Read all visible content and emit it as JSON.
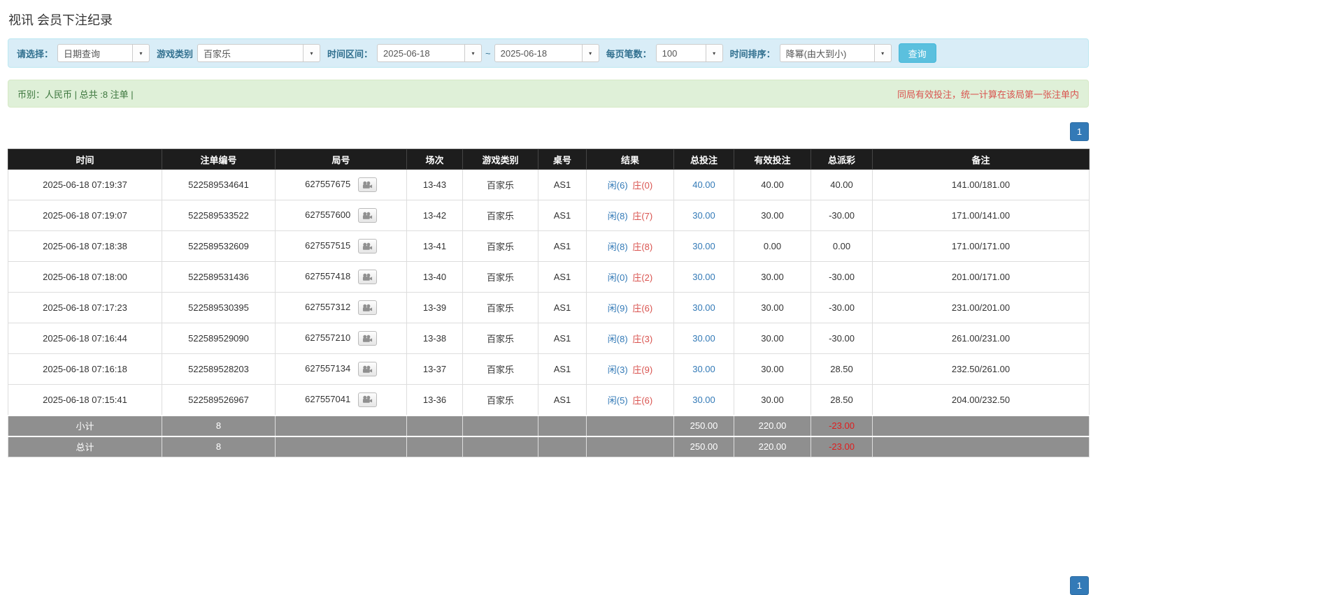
{
  "page": {
    "title": "视讯 会员下注纪录"
  },
  "filters": {
    "caret": "▾",
    "select_label": "请选择：",
    "select_value": "日期查询",
    "game_label": "游戏类别",
    "game_value": "百家乐",
    "range_label": "时间区间：",
    "date_from": "2025-06-18",
    "range_separator": "~",
    "date_to": "2025-06-18",
    "page_size_label": "每页笔数：",
    "page_size_value": "100",
    "sort_label": "时间排序：",
    "sort_value": "降幂(由大到小)",
    "search_label": "查询"
  },
  "summary_bar": {
    "left": "币别：人民币 | 总共 :8 注单 |",
    "right": "同局有效投注，统一计算在该局第一张注单内"
  },
  "pagination": {
    "current_page": "1"
  },
  "table": {
    "headers": [
      "时间",
      "注单编号",
      "局号",
      "场次",
      "游戏类别",
      "桌号",
      "结果",
      "总投注",
      "有效投注",
      "总派彩",
      "备注"
    ],
    "rows": [
      {
        "time": "2025-06-18 07:19:37",
        "bet_no": "522589534641",
        "round_no": "627557675",
        "session": "13-43",
        "game_type": "百家乐",
        "table_no": "AS1",
        "result_player": "闲(6)",
        "result_banker": "庄(0)",
        "total_bet": "40.00",
        "valid_bet": "40.00",
        "payout": "40.00",
        "note": "141.00/181.00"
      },
      {
        "time": "2025-06-18 07:19:07",
        "bet_no": "522589533522",
        "round_no": "627557600",
        "session": "13-42",
        "game_type": "百家乐",
        "table_no": "AS1",
        "result_player": "闲(8)",
        "result_banker": "庄(7)",
        "total_bet": "30.00",
        "valid_bet": "30.00",
        "payout": "-30.00",
        "note": "171.00/141.00"
      },
      {
        "time": "2025-06-18 07:18:38",
        "bet_no": "522589532609",
        "round_no": "627557515",
        "session": "13-41",
        "game_type": "百家乐",
        "table_no": "AS1",
        "result_player": "闲(8)",
        "result_banker": "庄(8)",
        "total_bet": "30.00",
        "valid_bet": "0.00",
        "payout": "0.00",
        "note": "171.00/171.00"
      },
      {
        "time": "2025-06-18 07:18:00",
        "bet_no": "522589531436",
        "round_no": "627557418",
        "session": "13-40",
        "game_type": "百家乐",
        "table_no": "AS1",
        "result_player": "闲(0)",
        "result_banker": "庄(2)",
        "total_bet": "30.00",
        "valid_bet": "30.00",
        "payout": "-30.00",
        "note": "201.00/171.00"
      },
      {
        "time": "2025-06-18 07:17:23",
        "bet_no": "522589530395",
        "round_no": "627557312",
        "session": "13-39",
        "game_type": "百家乐",
        "table_no": "AS1",
        "result_player": "闲(9)",
        "result_banker": "庄(6)",
        "total_bet": "30.00",
        "valid_bet": "30.00",
        "payout": "-30.00",
        "note": "231.00/201.00"
      },
      {
        "time": "2025-06-18 07:16:44",
        "bet_no": "522589529090",
        "round_no": "627557210",
        "session": "13-38",
        "game_type": "百家乐",
        "table_no": "AS1",
        "result_player": "闲(8)",
        "result_banker": "庄(3)",
        "total_bet": "30.00",
        "valid_bet": "30.00",
        "payout": "-30.00",
        "note": "261.00/231.00"
      },
      {
        "time": "2025-06-18 07:16:18",
        "bet_no": "522589528203",
        "round_no": "627557134",
        "session": "13-37",
        "game_type": "百家乐",
        "table_no": "AS1",
        "result_player": "闲(3)",
        "result_banker": "庄(9)",
        "total_bet": "30.00",
        "valid_bet": "30.00",
        "payout": "28.50",
        "note": "232.50/261.00"
      },
      {
        "time": "2025-06-18 07:15:41",
        "bet_no": "522589526967",
        "round_no": "627557041",
        "session": "13-36",
        "game_type": "百家乐",
        "table_no": "AS1",
        "result_player": "闲(5)",
        "result_banker": "庄(6)",
        "total_bet": "30.00",
        "valid_bet": "30.00",
        "payout": "28.50",
        "note": "204.00/232.50"
      }
    ],
    "subtotal": {
      "label": "小计",
      "count": "8",
      "total_bet": "250.00",
      "valid_bet": "220.00",
      "payout": "-23.00"
    },
    "total": {
      "label": "总计",
      "count": "8",
      "total_bet": "250.00",
      "valid_bet": "220.00",
      "payout": "-23.00"
    }
  }
}
